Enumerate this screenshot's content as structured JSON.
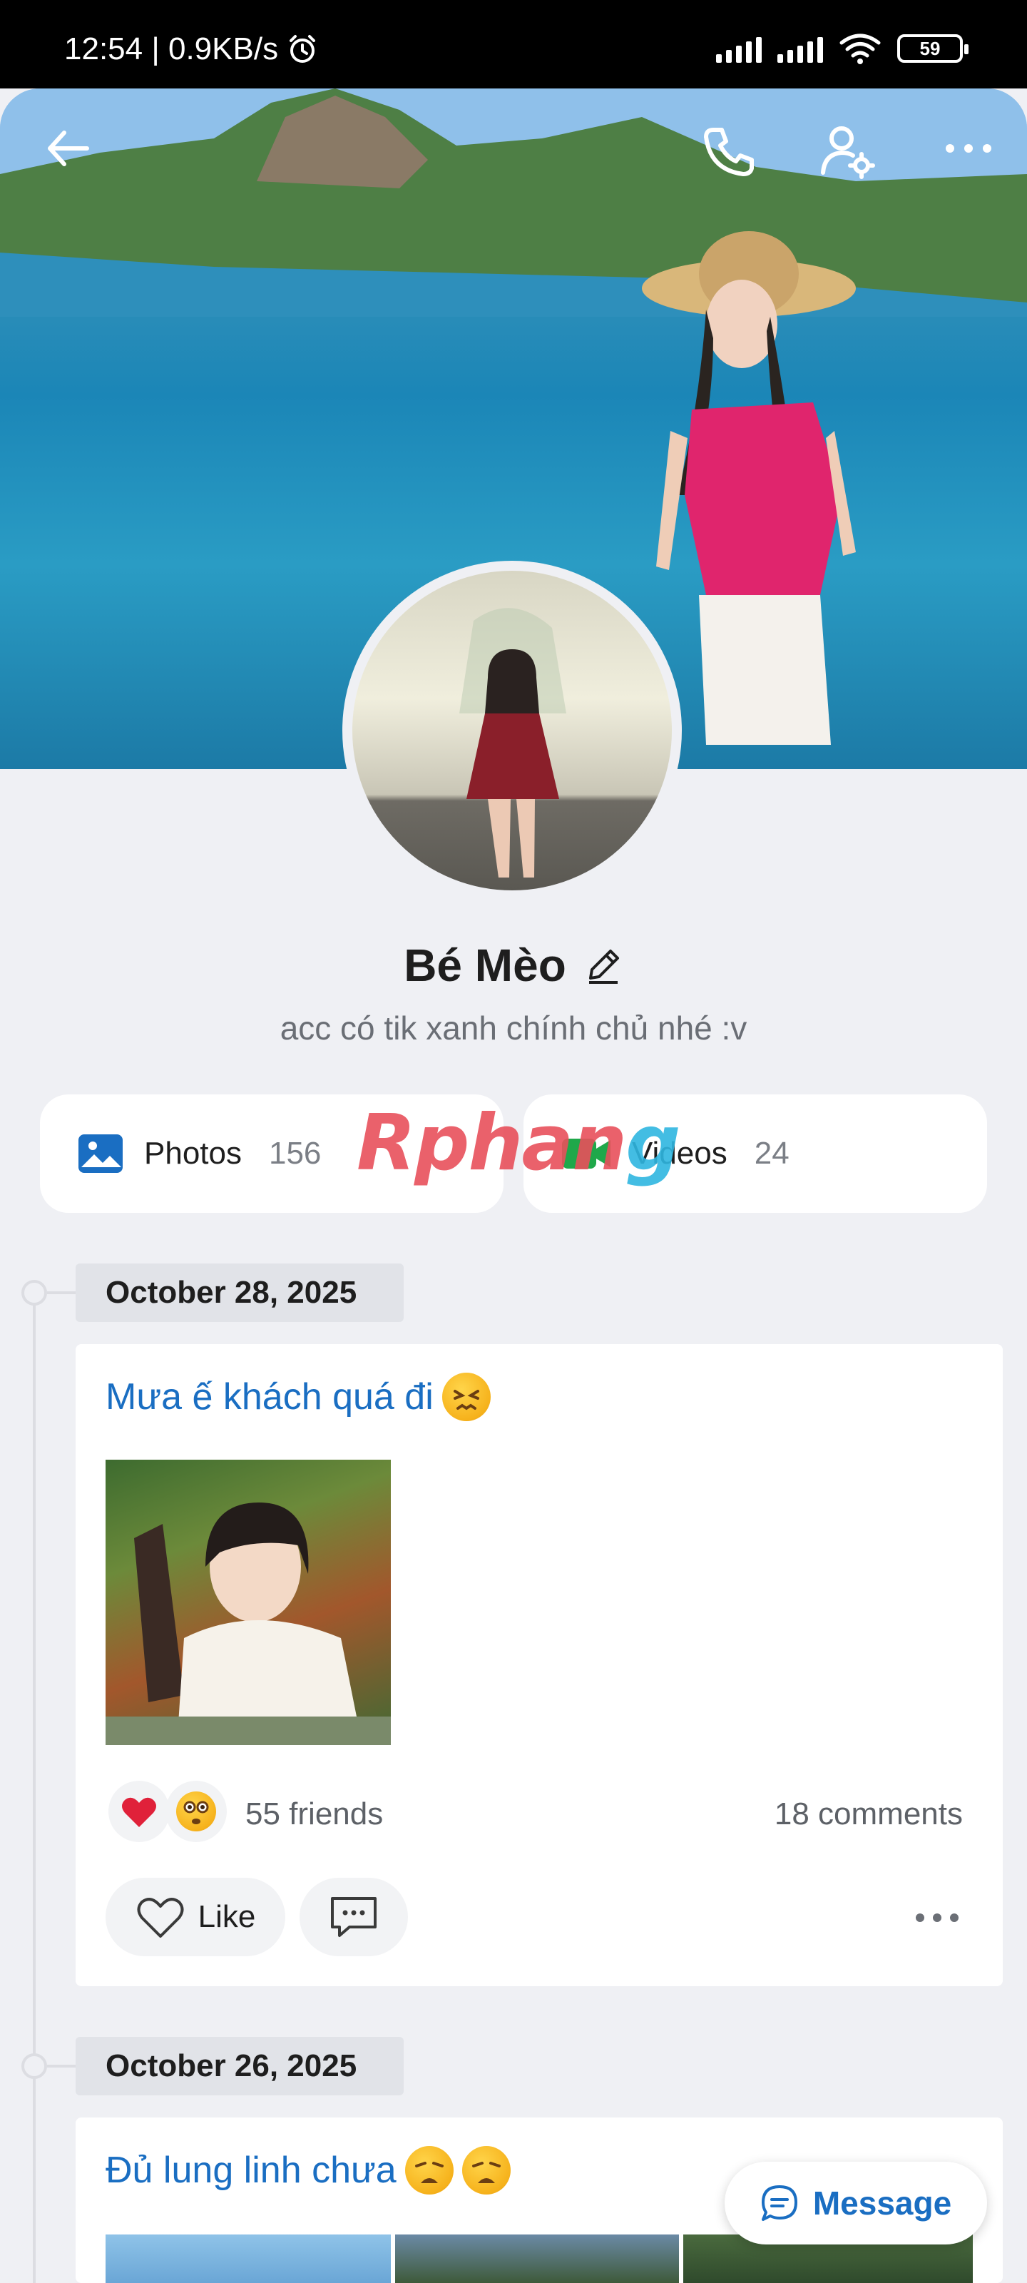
{
  "status_bar": {
    "time_speed": "12:54 | 0.9KB/s",
    "battery": "59"
  },
  "profile": {
    "name": "Bé Mèo",
    "bio": "acc có tik xanh chính chủ nhé :v"
  },
  "media": {
    "photos_label": "Photos",
    "photos_count": "156",
    "videos_label": "Videos",
    "videos_count": "24"
  },
  "watermark": {
    "part1": "Rphan",
    "part2": "g"
  },
  "posts": [
    {
      "date": "October 28, 2025",
      "title": "Mưa ế khách quá đi",
      "reactions_text": "55 friends",
      "comments_text": "18 comments",
      "like_label": "Like"
    },
    {
      "date": "October 26, 2025",
      "title": "Đủ lung linh chưa"
    }
  ],
  "message_button": "Message",
  "colors": {
    "accent": "#1a6ec2",
    "background": "#eff0f4",
    "heart": "#e0213a"
  }
}
